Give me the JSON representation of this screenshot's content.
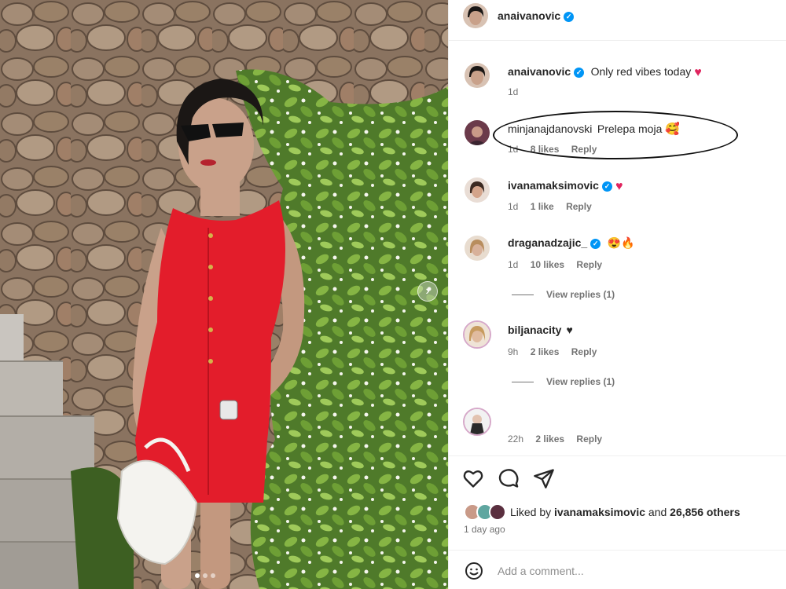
{
  "post": {
    "author": "anaivanovic",
    "caption": "Only red vibes today",
    "caption_time": "1d"
  },
  "comments": [
    {
      "username": "minjanajdanovski",
      "text": "Prelepa moja",
      "emoji": "face-with-hearts",
      "time": "1d",
      "likes": "8 likes",
      "reply": "Reply"
    },
    {
      "username": "ivanamaksimovic",
      "verified": true,
      "text": "",
      "emoji": "red-heart",
      "time": "1d",
      "likes": "1 like",
      "reply": "Reply"
    },
    {
      "username": "draganadzajic_",
      "verified": true,
      "text": "",
      "emoji": "heart-eyes-fire",
      "time": "1d",
      "likes": "10 likes",
      "reply": "Reply",
      "view_replies": "View replies (1)"
    },
    {
      "username": "biljanacity",
      "text": "",
      "emoji": "black-heart",
      "time": "9h",
      "likes": "2 likes",
      "reply": "Reply",
      "view_replies": "View replies (1)"
    },
    {
      "username": "",
      "text": "",
      "time": "22h",
      "likes": "2 likes",
      "reply": "Reply"
    }
  ],
  "likes": {
    "prefix": "Liked by",
    "user": "ivanamaksimovic",
    "and": "and",
    "count": "26,856 others"
  },
  "posted": "1 day ago",
  "add_comment": {
    "placeholder": "Add a comment..."
  },
  "colors": {
    "accent": "#0095f6",
    "heart": "#e0245e",
    "dress": "#e31d2b"
  },
  "carousel": {
    "total": 3,
    "current": 1
  }
}
